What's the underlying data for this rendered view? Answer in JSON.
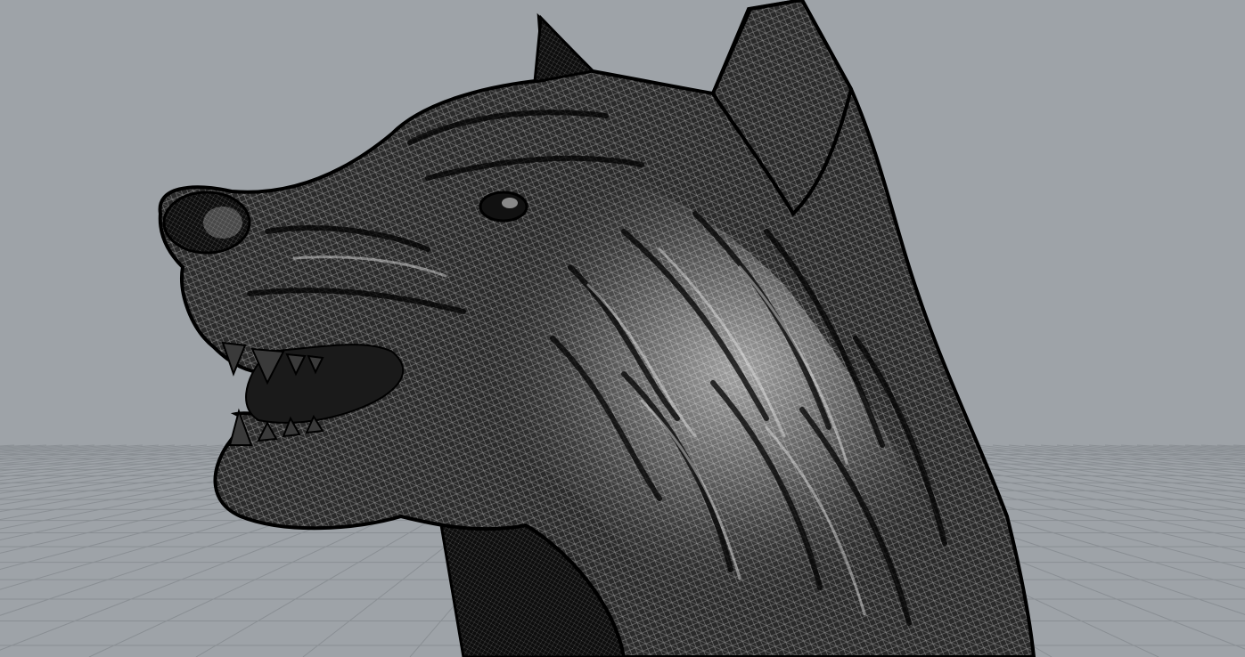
{
  "viewport": {
    "background": "#9ea3a8",
    "grid_color": "#8a8f94",
    "model": {
      "name": "wolf-head-mesh",
      "display_mode": "wireframe-shaded",
      "mesh_dark": "#101010",
      "mesh_light": "#e9e9e9"
    }
  }
}
